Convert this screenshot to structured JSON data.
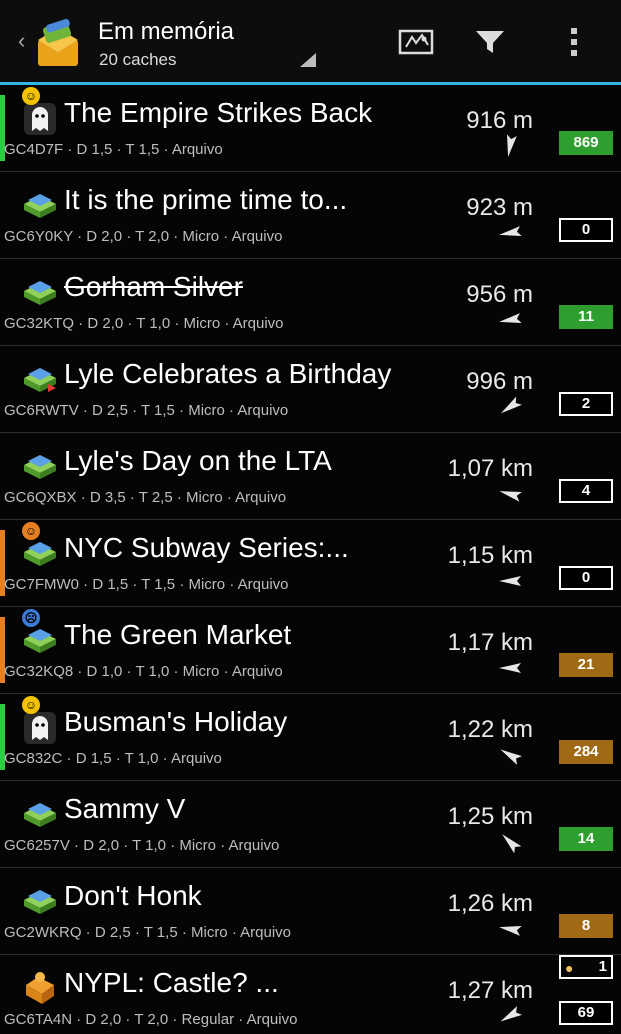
{
  "header": {
    "title": "Em memória",
    "subtitle": "20 caches",
    "icons": [
      "up-caret-icon",
      "app-icon",
      "map-icon",
      "filter-icon",
      "overflow-menu-icon"
    ]
  },
  "colors": {
    "accent": "#33b5e5",
    "green_count": "#2e9e2e",
    "brown_count": "#a06a14",
    "stripe_green": "#2ecc40",
    "stripe_orange": "#e67e22"
  },
  "caches": [
    {
      "name": "The Empire Strikes Back",
      "info": "GC4D7F · D 1,5 · T 1,5 · Arquivo",
      "distance": "916 m",
      "count": "869",
      "count_style": "green",
      "icon": "ghost-icon",
      "badge": "☺",
      "badge_color": "#f3c300",
      "stripe": "#2ecc40",
      "strike": false,
      "arrow_rotate": -80
    },
    {
      "name": "It is the prime time to...",
      "info": "GC6Y0KY · D 2,0 · T 2,0 · Micro · Arquivo",
      "distance": "923 m",
      "count": "0",
      "count_style": "white",
      "icon": "traditional-cache-icon",
      "badge": "",
      "badge_color": "",
      "stripe": "",
      "strike": false,
      "arrow_rotate": -10
    },
    {
      "name": "Gorham Silver",
      "info": "GC32KTQ · D 2,0 · T 1,0 · Micro · Arquivo",
      "distance": "956 m",
      "count": "11",
      "count_style": "green",
      "icon": "traditional-cache-icon",
      "badge": "",
      "badge_color": "",
      "stripe": "",
      "strike": true,
      "arrow_rotate": -10
    },
    {
      "name": "Lyle Celebrates a Birthday",
      "info": "GC6RWTV · D 2,5 · T 1,5 · Micro · Arquivo",
      "distance": "996 m",
      "count": "2",
      "count_style": "white",
      "icon": "traditional-cache-flag-icon",
      "badge": "",
      "badge_color": "",
      "stripe": "",
      "strike": false,
      "arrow_rotate": -35
    },
    {
      "name": "Lyle's Day on the LTA",
      "info": "GC6QXBX · D 3,5 · T 2,5 · Micro · Arquivo",
      "distance": "1,07 km",
      "count": "4",
      "count_style": "white",
      "icon": "traditional-cache-icon",
      "badge": "",
      "badge_color": "",
      "stripe": "",
      "strike": false,
      "arrow_rotate": 15
    },
    {
      "name": "NYC Subway Series:...",
      "info": "GC7FMW0 · D 1,5 · T 1,5 · Micro · Arquivo",
      "distance": "1,15 km",
      "count": "0",
      "count_style": "white",
      "icon": "traditional-cache-icon",
      "badge": "☺",
      "badge_color": "#e67e22",
      "stripe": "#e67e22",
      "strike": false,
      "arrow_rotate": 0
    },
    {
      "name": "The Green Market",
      "info": "GC32KQ8 · D 1,0 · T 1,0 · Micro · Arquivo",
      "distance": "1,17 km",
      "count": "21",
      "count_style": "brown",
      "icon": "traditional-cache-icon",
      "badge": "☹",
      "badge_color": "#3a7bd5",
      "stripe": "#e67e22",
      "strike": false,
      "arrow_rotate": 0
    },
    {
      "name": "Busman's Holiday",
      "info": "GC832C · D 1,5 · T 1,0 · Arquivo",
      "distance": "1,22 km",
      "count": "284",
      "count_style": "brown",
      "icon": "ghost-icon",
      "badge": "☺",
      "badge_color": "#f3c300",
      "stripe": "#2ecc40",
      "strike": false,
      "arrow_rotate": 30
    },
    {
      "name": "Sammy V",
      "info": "GC6257V · D 2,0 · T 1,0 · Micro · Arquivo",
      "distance": "1,25 km",
      "count": "14",
      "count_style": "green",
      "icon": "traditional-cache-icon",
      "badge": "",
      "badge_color": "",
      "stripe": "",
      "strike": false,
      "arrow_rotate": 45
    },
    {
      "name": "Don't Honk",
      "info": "GC2WKRQ · D 2,5 · T 1,5 · Micro · Arquivo",
      "distance": "1,26 km",
      "count": "8",
      "count_style": "brown",
      "icon": "traditional-cache-icon",
      "badge": "",
      "badge_color": "",
      "stripe": "",
      "strike": false,
      "arrow_rotate": 10
    },
    {
      "name": "NYPL: Castle? ...",
      "info": "GC6TA4N · D 2,0 · T 2,0 · Regular · Arquivo",
      "distance": "1,27 km",
      "count": "69",
      "count_style": "white",
      "icon": "puzzle-cache-icon",
      "badge": "",
      "badge_color": "",
      "stripe": "",
      "strike": false,
      "arrow_rotate": -30,
      "inventory": "1"
    }
  ]
}
